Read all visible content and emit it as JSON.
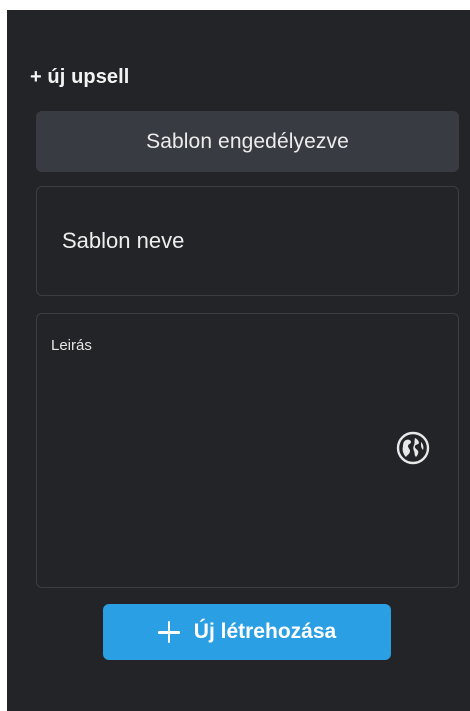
{
  "panel": {
    "heading": "+ új upsell",
    "template_enabled_label": "Sablon engedélyezve",
    "name_field": {
      "value": "Sablon neve"
    },
    "description_field": {
      "label": "Leirás",
      "value": "",
      "icon": "globe-icon"
    },
    "create_button": {
      "label": "Új létrehozása",
      "icon": "plus-icon"
    }
  },
  "colors": {
    "panel_bg": "#222427",
    "toggle_bg": "#393b42",
    "border": "#3a3d42",
    "accent": "#2b9fe3",
    "text": "#eeeeee"
  }
}
